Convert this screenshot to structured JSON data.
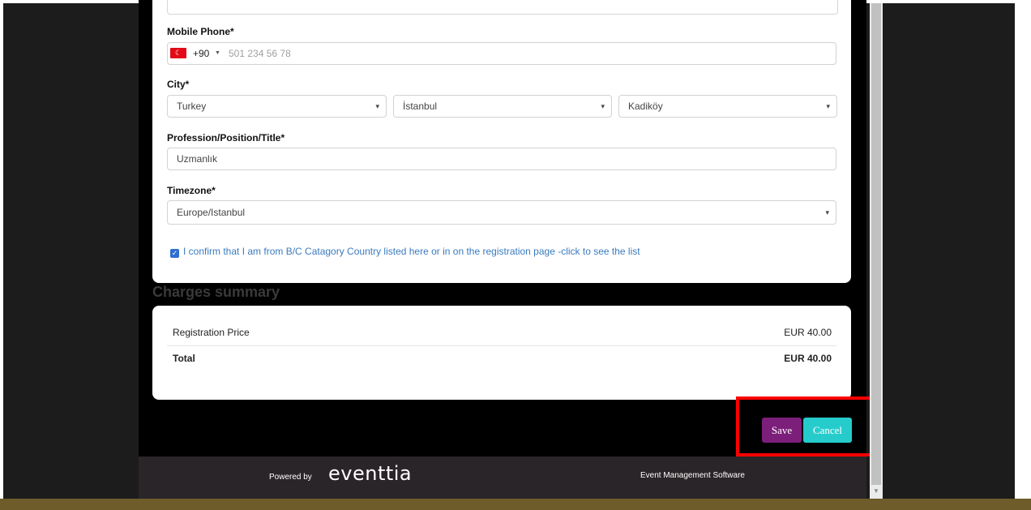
{
  "form": {
    "mobile_phone": {
      "label": "Mobile Phone*",
      "country_code": "+90",
      "placeholder": "501 234 56 78"
    },
    "city": {
      "label": "City*",
      "country": "Turkey",
      "province": "İstanbul",
      "district": "Kadiköy"
    },
    "profession": {
      "label": "Profession/Position/Title*",
      "value": "Uzmanlık"
    },
    "timezone": {
      "label": "Timezone*",
      "value": "Europe/Istanbul"
    },
    "confirm_text": "I confirm that I am from B/C Catagory Country listed here or in on the registration page -click to see the list"
  },
  "charges": {
    "heading": "Charges summary",
    "rows": [
      {
        "label": "Registration Price",
        "value": "EUR 40.00"
      },
      {
        "label": "Total",
        "value": "EUR 40.00"
      }
    ]
  },
  "actions": {
    "save_label": "Save",
    "cancel_label": "Cancel"
  },
  "footer": {
    "powered_by": "Powered by",
    "brand": "eventtia",
    "tagline": "Event Management Software"
  },
  "colors": {
    "save": "#7b1f7a",
    "cancel": "#26cccc",
    "highlight": "#ff0000"
  }
}
